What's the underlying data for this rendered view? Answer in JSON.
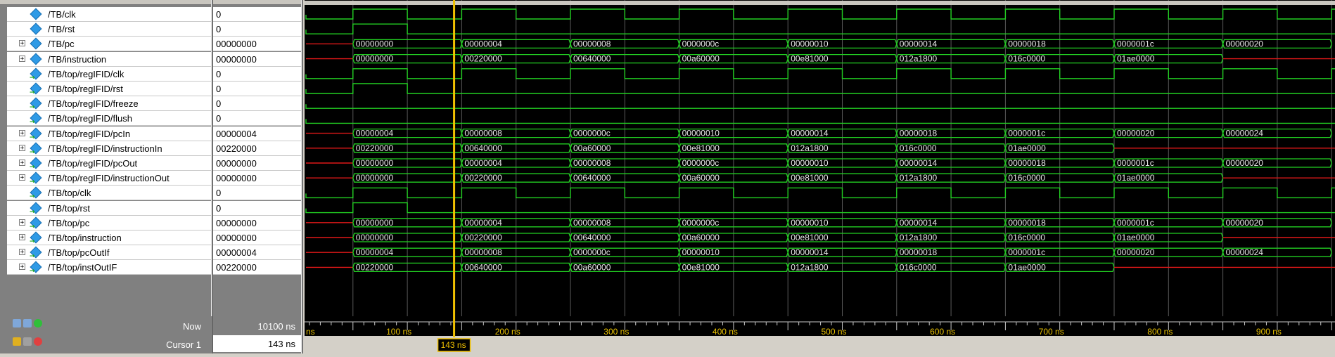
{
  "signals": [
    {
      "name": "/TB/clk",
      "value": "0",
      "expandable": false
    },
    {
      "name": "/TB/rst",
      "value": "0",
      "expandable": false
    },
    {
      "name": "/TB/pc",
      "value": "00000000",
      "expandable": true
    },
    {
      "name": "/TB/instruction",
      "value": "00000000",
      "expandable": true
    },
    {
      "name": "/TB/top/regIFID/clk",
      "value": "0",
      "expandable": false
    },
    {
      "name": "/TB/top/regIFID/rst",
      "value": "0",
      "expandable": false
    },
    {
      "name": "/TB/top/regIFID/freeze",
      "value": "0",
      "expandable": false
    },
    {
      "name": "/TB/top/regIFID/flush",
      "value": "0",
      "expandable": false
    },
    {
      "name": "/TB/top/regIFID/pcIn",
      "value": "00000004",
      "expandable": true
    },
    {
      "name": "/TB/top/regIFID/instructionIn",
      "value": "00220000",
      "expandable": true
    },
    {
      "name": "/TB/top/regIFID/pcOut",
      "value": "00000000",
      "expandable": true
    },
    {
      "name": "/TB/top/regIFID/instructionOut",
      "value": "00000000",
      "expandable": true
    },
    {
      "name": "/TB/top/clk",
      "value": "0",
      "expandable": false
    },
    {
      "name": "/TB/top/rst",
      "value": "0",
      "expandable": false
    },
    {
      "name": "/TB/top/pc",
      "value": "00000000",
      "expandable": true
    },
    {
      "name": "/TB/top/instruction",
      "value": "00000000",
      "expandable": true
    },
    {
      "name": "/TB/top/pcOutIf",
      "value": "00000004",
      "expandable": true
    },
    {
      "name": "/TB/top/instOutIF",
      "value": "00220000",
      "expandable": true
    }
  ],
  "status": {
    "now_label": "Now",
    "now_value": "10100 ns",
    "cursor_label": "Cursor 1",
    "cursor_value": "143 ns",
    "cursor_tag": "143 ns"
  },
  "timeline": {
    "ticks": [
      "100 ns",
      "200 ns",
      "300 ns",
      "400 ns",
      "500 ns",
      "600 ns",
      "700 ns",
      "800 ns",
      "900 ns"
    ],
    "left_fragment": "ns"
  },
  "colors": {
    "wave_green": "#22d022",
    "undefined_red": "#e01818",
    "cursor_yellow": "#f0c000",
    "grid": "#5a5a5a"
  },
  "waves": {
    "clk_periods_ns": 100,
    "reset_high_until_ns": 100,
    "bus": {
      "pc": [
        "00000000",
        "00000004",
        "00000008",
        "0000000c",
        "00000010",
        "00000014",
        "00000018",
        "0000001c",
        "00000020"
      ],
      "instruction": [
        "00000000",
        "00220000",
        "00640000",
        "00a60000",
        "00e81000",
        "012a1800",
        "016c0000",
        "01ae0000"
      ],
      "pcIn": [
        "00000004",
        "00000008",
        "0000000c",
        "00000010",
        "00000014",
        "00000018",
        "0000001c",
        "00000020",
        "00000024"
      ],
      "instructionIn": [
        "00220000",
        "00640000",
        "00a60000",
        "00e81000",
        "012a1800",
        "016c0000",
        "01ae0000"
      ],
      "pcOut": [
        "00000000",
        "00000004",
        "00000008",
        "0000000c",
        "00000010",
        "00000014",
        "00000018",
        "0000001c",
        "00000020"
      ],
      "instructionOut": [
        "00000000",
        "00220000",
        "00640000",
        "00a60000",
        "00e81000",
        "012a1800",
        "016c0000",
        "01ae0000"
      ],
      "top_pc": [
        "00000000",
        "00000004",
        "00000008",
        "0000000c",
        "00000010",
        "00000014",
        "00000018",
        "0000001c",
        "00000020"
      ],
      "top_instruction": [
        "00000000",
        "00220000",
        "00640000",
        "00a60000",
        "00e81000",
        "012a1800",
        "016c0000",
        "01ae0000"
      ],
      "pcOutIf": [
        "00000004",
        "00000008",
        "0000000c",
        "00000010",
        "00000014",
        "00000018",
        "0000001c",
        "00000020",
        "00000024"
      ],
      "instOutIF": [
        "00220000",
        "00640000",
        "00a60000",
        "00e81000",
        "012a1800",
        "016c0000",
        "01ae0000"
      ]
    }
  }
}
